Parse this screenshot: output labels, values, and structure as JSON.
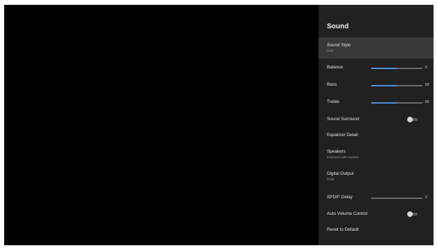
{
  "panel": {
    "title": "Sound",
    "items": [
      {
        "label": "Sound Style",
        "sub": "User"
      },
      {
        "label": "Balance",
        "value": "0",
        "fill": 0.5
      },
      {
        "label": "Bass",
        "value": "50",
        "fill": 0.5
      },
      {
        "label": "Treble",
        "value": "50",
        "fill": 0.5
      },
      {
        "label": "Sound Surround",
        "toggle": "off"
      },
      {
        "label": "Equalizer Detail"
      },
      {
        "label": "Speakers",
        "sub": "External Audio System"
      },
      {
        "label": "Digital Output",
        "sub": "PCM"
      },
      {
        "label": "SPDIF Delay",
        "value": "0",
        "fill": 0
      },
      {
        "label": "Auto Volume Control",
        "toggle": "off"
      },
      {
        "label": "Reset to Default"
      }
    ]
  },
  "colors": {
    "panel_bg": "#212121",
    "selected_bg": "#383838",
    "accent": "#4f8fdc",
    "screen_bg": "#000000"
  }
}
